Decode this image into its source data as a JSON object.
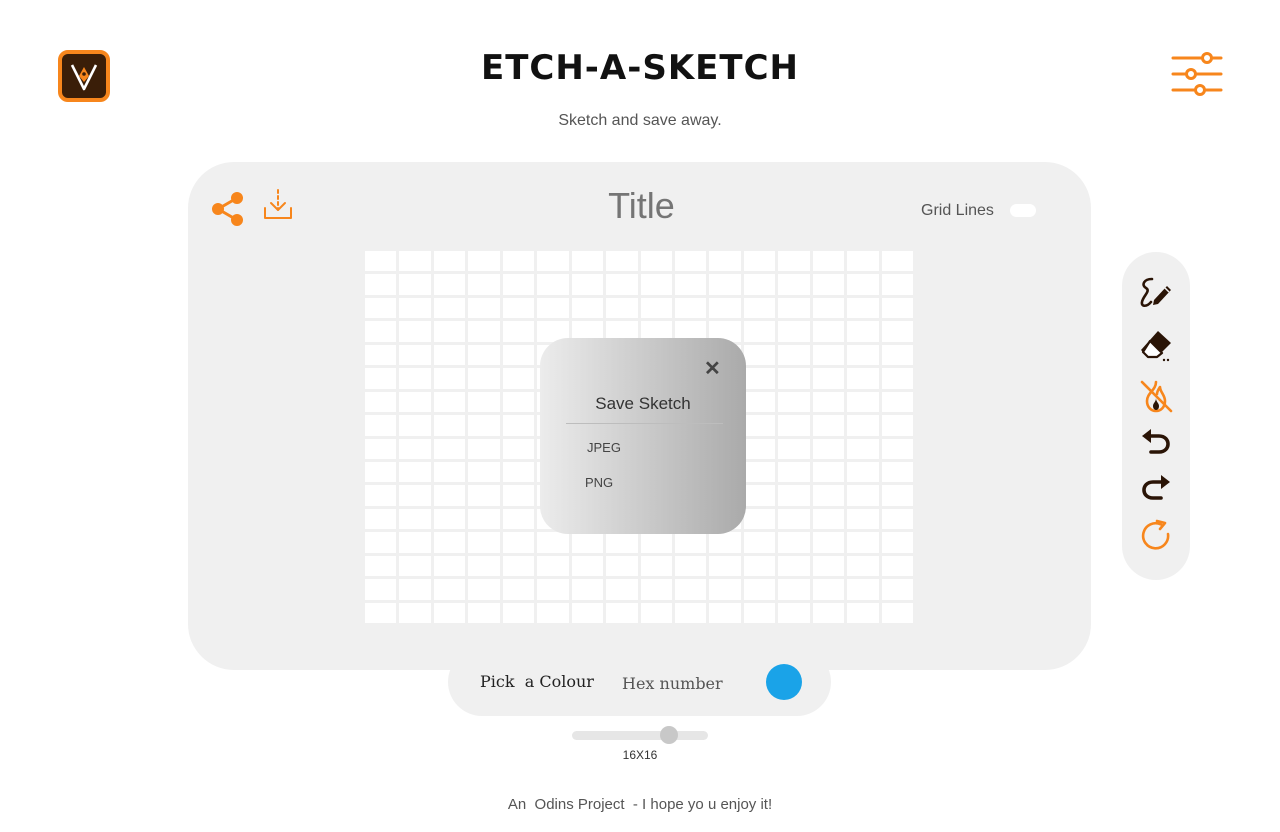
{
  "header": {
    "title": "ETCH-A-SKETCH",
    "subtitle": "Sketch and save away.",
    "logo_icon": "pen-nib-logo-icon",
    "settings_icon": "sliders-icon"
  },
  "board": {
    "sketch_title_placeholder": "Title",
    "share_icon": "share-icon",
    "download_icon": "download-icon",
    "grid_lines_label": "Grid Lines",
    "grid_lines_on": false,
    "grid_size": 16
  },
  "save_modal": {
    "heading": "Save Sketch",
    "close_icon": "close-icon",
    "options": [
      "JPEG",
      "PNG"
    ]
  },
  "colour_picker": {
    "label": "Pick  a Colour",
    "hex_placeholder": "Hex number",
    "current_colour": "#1aa3e8"
  },
  "tools": [
    {
      "name": "draw",
      "icon": "pen-scribble-icon"
    },
    {
      "name": "eraser",
      "icon": "eraser-icon"
    },
    {
      "name": "rainbow",
      "icon": "flame-off-icon"
    },
    {
      "name": "undo",
      "icon": "undo-icon"
    },
    {
      "name": "redo",
      "icon": "redo-icon"
    },
    {
      "name": "reset",
      "icon": "refresh-icon"
    }
  ],
  "size_slider": {
    "label": "16X16",
    "value": 16,
    "min": 1,
    "max": 22
  },
  "footer": {
    "text": "An  Odins Project  - I hope yo u enjoy it!"
  },
  "colors": {
    "accent": "#f7861c",
    "panel": "#f0f0f0",
    "icon_dark": "#2a1406"
  }
}
